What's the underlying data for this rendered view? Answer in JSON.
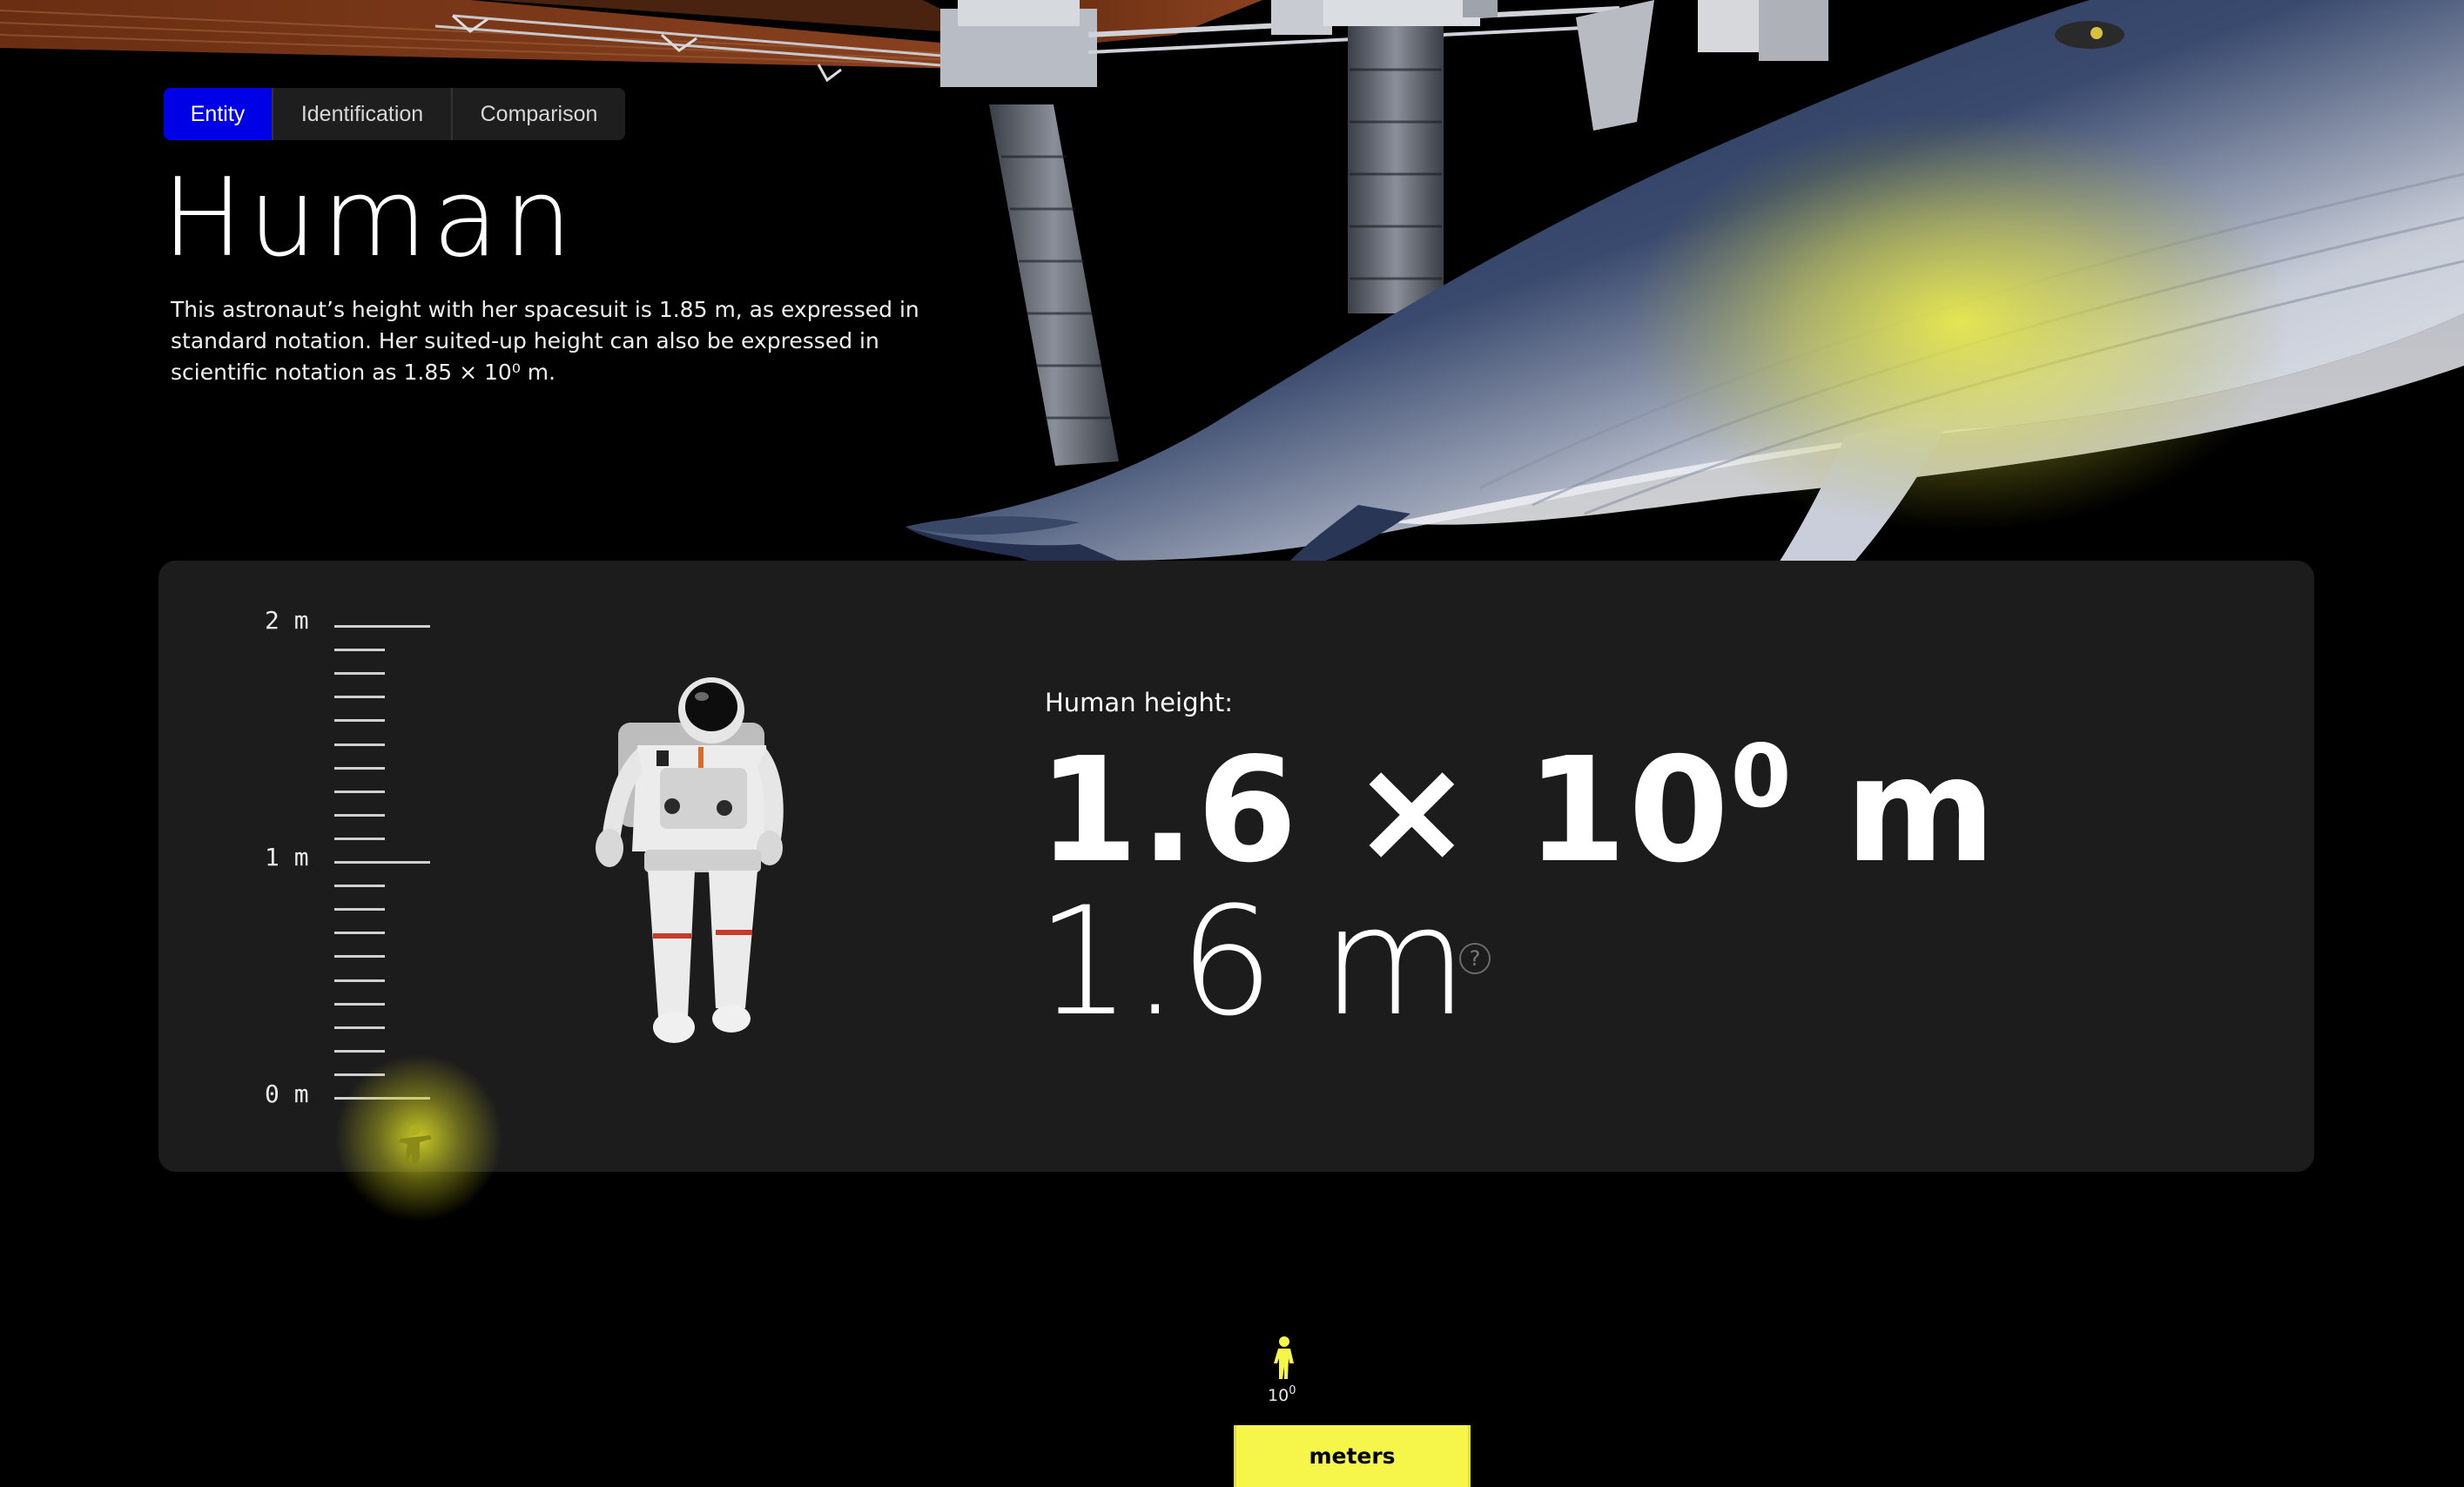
{
  "tabs": [
    {
      "label": "Entity",
      "active": true
    },
    {
      "label": "Identification",
      "active": false
    },
    {
      "label": "Comparison",
      "active": false
    }
  ],
  "entity": {
    "title": "Human",
    "description": "This astronaut’s height with her spacesuit is 1.85 m, as expressed in standard notation. Her suited-up height can also be expressed in scientific notation as 1.85 × 10⁰ m."
  },
  "ruler": {
    "top_label": "2 m",
    "mid_label": "1 m",
    "bottom_label": "0 m"
  },
  "measurement": {
    "caption": "Human height:",
    "sci_mantissa": "1.6 × 10",
    "sci_exponent": "0",
    "sci_unit": " m",
    "standard": "1.6 m",
    "help_glyph": "?"
  },
  "scale": {
    "power_base": "10",
    "power_exponent": "0",
    "unit_label": "meters"
  },
  "colors": {
    "active_tab": "#0000e6",
    "highlight": "#f5f54a",
    "panel": "#1c1c1c"
  },
  "icons": {
    "scale_marker": "human-silhouette-icon",
    "help": "question-circle-icon"
  }
}
